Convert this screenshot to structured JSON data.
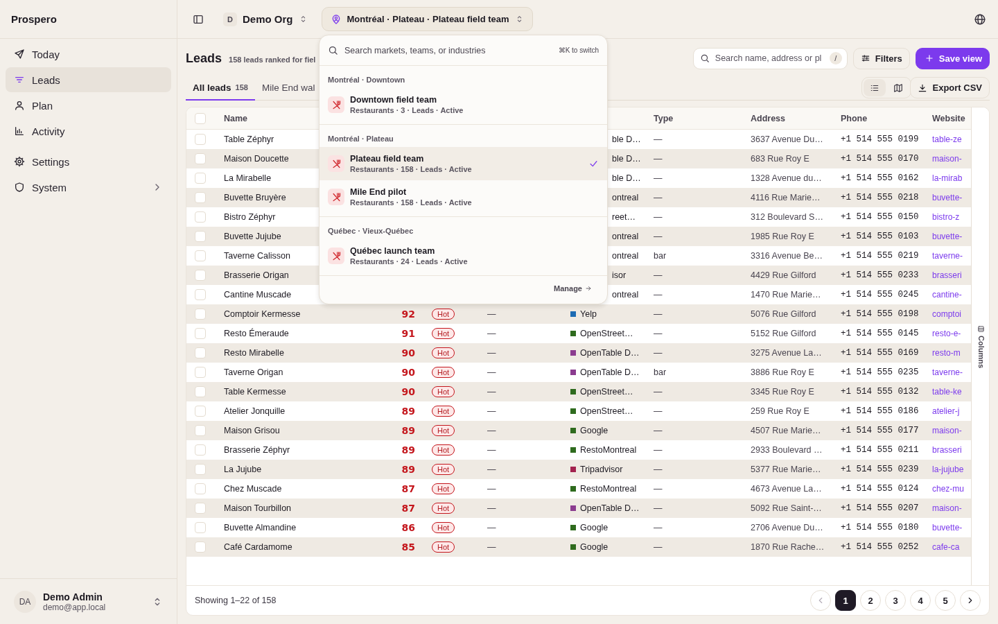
{
  "sidebar": {
    "brand": "Prospero",
    "sections": [
      {
        "items": [
          {
            "label": "Today",
            "selected": false,
            "expandable": false
          },
          {
            "label": "Leads",
            "selected": true,
            "expandable": false
          },
          {
            "label": "Plan",
            "selected": false,
            "expandable": false
          },
          {
            "label": "Activity",
            "selected": false,
            "expandable": false
          }
        ]
      },
      {
        "items": [
          {
            "label": "Settings",
            "selected": false,
            "expandable": false
          },
          {
            "label": "System",
            "selected": false,
            "expandable": true
          }
        ]
      }
    ],
    "user": {
      "initials": "DA",
      "name": "Demo Admin",
      "email": "demo@app.local"
    }
  },
  "topbar": {
    "org": {
      "initial": "D",
      "name": "Demo Org"
    },
    "location": "Montréal · Plateau · Plateau field team",
    "location_open": true
  },
  "header": {
    "title": "Leads",
    "subtitle": "158 leads ranked for fiel",
    "search": {
      "placeholder": "Search name, address or pl",
      "shortcut": "/"
    },
    "filters": "Filters",
    "save": "Save view",
    "tabs": [
      {
        "label": "All leads",
        "count": "158",
        "selected": true
      },
      {
        "label": "Mile End wal",
        "selected": false
      }
    ],
    "views": [
      {
        "selected": true
      },
      {
        "selected": false
      }
    ],
    "export": "Export CSV"
  },
  "table": {
    "select_all": {
      "checked": false
    },
    "columns": [
      {
        "label": "Name"
      },
      {
        "label": "Type"
      },
      {
        "label": "Address"
      },
      {
        "label": "Phone"
      },
      {
        "label": "Website"
      }
    ],
    "rows": [
      {
        "checked": false,
        "covered": true,
        "name": "Table Zéphyr",
        "source": {
          "text": "ble D…"
        },
        "type": "—",
        "address": "3637 Avenue Du…",
        "phone": "+1 514 555 0199",
        "website": "table-ze"
      },
      {
        "checked": false,
        "covered": true,
        "name": "Maison Doucette",
        "source": {
          "text": "ble D…"
        },
        "type": "—",
        "address": "683 Rue Roy E",
        "phone": "+1 514 555 0170",
        "website": "maison-"
      },
      {
        "checked": false,
        "covered": true,
        "name": "La Mirabelle",
        "source": {
          "text": "ble D…"
        },
        "type": "—",
        "address": "1328 Avenue du…",
        "phone": "+1 514 555 0162",
        "website": "la-mirab"
      },
      {
        "checked": false,
        "covered": true,
        "name": "Buvette Bruyère",
        "source": {
          "text": "ontreal"
        },
        "type": "—",
        "address": "4116 Rue Marie…",
        "phone": "+1 514 555 0218",
        "website": "buvette-"
      },
      {
        "checked": false,
        "covered": true,
        "name": "Bistro Zéphyr",
        "source": {
          "text": "reet…"
        },
        "type": "—",
        "address": "312 Boulevard S…",
        "phone": "+1 514 555 0150",
        "website": "bistro-z"
      },
      {
        "checked": false,
        "covered": true,
        "name": "Buvette Jujube",
        "source": {
          "text": "ontreal"
        },
        "type": "—",
        "address": "1985 Rue Roy E",
        "phone": "+1 514 555 0103",
        "website": "buvette-"
      },
      {
        "checked": false,
        "covered": true,
        "name": "Taverne Calisson",
        "source": {
          "text": "ontreal"
        },
        "type": "bar",
        "address": "3316 Avenue Be…",
        "phone": "+1 514 555 0219",
        "website": "taverne-"
      },
      {
        "checked": false,
        "covered": true,
        "name": "Brasserie Origan",
        "source": {
          "text": "isor"
        },
        "type": "—",
        "address": "4429 Rue Gilford",
        "phone": "+1 514 555 0233",
        "website": "brasseri"
      },
      {
        "checked": false,
        "covered": true,
        "name": "Cantine Muscade",
        "source": {
          "text": "ontreal"
        },
        "type": "—",
        "address": "1470 Rue Marie…",
        "phone": "+1 514 555 0245",
        "website": "cantine-"
      },
      {
        "checked": false,
        "covered": false,
        "name": "Comptoir Kermesse",
        "score": "92",
        "status": {
          "label": "Hot",
          "kind": "hot"
        },
        "column_4": "—",
        "source": {
          "text": "Yelp",
          "color": "#1d6bb3"
        },
        "type": "—",
        "address": "5076 Rue Gilford",
        "phone": "+1 514 555 0198",
        "website": "comptoi"
      },
      {
        "checked": false,
        "covered": false,
        "name": "Resto Émeraude",
        "score": "91",
        "status": {
          "label": "Hot",
          "kind": "hot"
        },
        "column_4": "—",
        "source": {
          "text": "OpenStreet…",
          "color": "#2f6b1e"
        },
        "type": "—",
        "address": "5152 Rue Gilford",
        "phone": "+1 514 555 0145",
        "website": "resto-e-"
      },
      {
        "checked": false,
        "covered": false,
        "name": "Resto Mirabelle",
        "score": "90",
        "status": {
          "label": "Hot",
          "kind": "hot"
        },
        "column_4": "—",
        "source": {
          "text": "OpenTable D…",
          "color": "#8b3c8f"
        },
        "type": "—",
        "address": "3275 Avenue La…",
        "phone": "+1 514 555 0169",
        "website": "resto-m"
      },
      {
        "checked": false,
        "covered": false,
        "name": "Taverne Origan",
        "score": "90",
        "status": {
          "label": "Hot",
          "kind": "hot"
        },
        "column_4": "—",
        "source": {
          "text": "OpenTable D…",
          "color": "#8b3c8f"
        },
        "type": "bar",
        "address": "3886 Rue Roy E",
        "phone": "+1 514 555 0235",
        "website": "taverne-"
      },
      {
        "checked": false,
        "covered": false,
        "name": "Table Kermesse",
        "score": "90",
        "status": {
          "label": "Hot",
          "kind": "hot"
        },
        "column_4": "—",
        "source": {
          "text": "OpenStreet…",
          "color": "#2f6b1e"
        },
        "type": "—",
        "address": "3345 Rue Roy E",
        "phone": "+1 514 555 0132",
        "website": "table-ke"
      },
      {
        "checked": false,
        "covered": false,
        "name": "Atelier Jonquille",
        "score": "89",
        "status": {
          "label": "Hot",
          "kind": "hot"
        },
        "column_4": "—",
        "source": {
          "text": "OpenStreet…",
          "color": "#2f6b1e"
        },
        "type": "—",
        "address": "259 Rue Roy E",
        "phone": "+1 514 555 0186",
        "website": "atelier-j"
      },
      {
        "checked": false,
        "covered": false,
        "name": "Maison Grisou",
        "score": "89",
        "status": {
          "label": "Hot",
          "kind": "hot"
        },
        "column_4": "—",
        "source": {
          "text": "Google",
          "color": "#2f6b1e"
        },
        "type": "—",
        "address": "4507 Rue Marie…",
        "phone": "+1 514 555 0177",
        "website": "maison-"
      },
      {
        "checked": false,
        "covered": false,
        "name": "Brasserie Zéphyr",
        "score": "89",
        "status": {
          "label": "Hot",
          "kind": "hot"
        },
        "column_4": "—",
        "source": {
          "text": "RestoMontreal",
          "color": "#2f6b1e"
        },
        "type": "—",
        "address": "2933 Boulevard …",
        "phone": "+1 514 555 0211",
        "website": "brasseri"
      },
      {
        "checked": false,
        "covered": false,
        "name": "La Jujube",
        "score": "89",
        "status": {
          "label": "Hot",
          "kind": "hot"
        },
        "column_4": "—",
        "source": {
          "text": "Tripadvisor",
          "color": "#a3234f"
        },
        "type": "—",
        "address": "5377 Rue Marie…",
        "phone": "+1 514 555 0239",
        "website": "la-jujube"
      },
      {
        "checked": false,
        "covered": false,
        "name": "Chez Muscade",
        "score": "87",
        "status": {
          "label": "Hot",
          "kind": "hot"
        },
        "column_4": "—",
        "source": {
          "text": "RestoMontreal",
          "color": "#2f6b1e"
        },
        "type": "—",
        "address": "4673 Avenue La…",
        "phone": "+1 514 555 0124",
        "website": "chez-mu"
      },
      {
        "checked": false,
        "covered": false,
        "name": "Maison Tourbillon",
        "score": "87",
        "status": {
          "label": "Hot",
          "kind": "hot"
        },
        "column_4": "—",
        "source": {
          "text": "OpenTable D…",
          "color": "#8b3c8f"
        },
        "type": "—",
        "address": "5092 Rue Saint-…",
        "phone": "+1 514 555 0207",
        "website": "maison-"
      },
      {
        "checked": false,
        "covered": false,
        "name": "Buvette Almandine",
        "score": "86",
        "status": {
          "label": "Hot",
          "kind": "hot"
        },
        "column_4": "—",
        "source": {
          "text": "Google",
          "color": "#2f6b1e"
        },
        "type": "—",
        "address": "2706 Avenue Du…",
        "phone": "+1 514 555 0180",
        "website": "buvette-"
      },
      {
        "checked": false,
        "covered": false,
        "name": "Café Cardamome",
        "score": "85",
        "status": {
          "label": "Hot",
          "kind": "hot"
        },
        "column_4": "—",
        "source": {
          "text": "Google",
          "color": "#2f6b1e"
        },
        "type": "—",
        "address": "1870 Rue Rache…",
        "phone": "+1 514 555 0252",
        "website": "cafe-ca"
      }
    ],
    "columns_toggle": "Columns"
  },
  "pagination": {
    "summary": "Showing 1–22 of 158",
    "prev_disabled": true,
    "next_disabled": false,
    "pages": [
      {
        "label": "1",
        "selected": true
      },
      {
        "label": "2",
        "selected": false
      },
      {
        "label": "3",
        "selected": false
      },
      {
        "label": "4",
        "selected": false
      },
      {
        "label": "5",
        "selected": false
      }
    ]
  },
  "location_menu": {
    "search_placeholder": "Search markets, teams, or industries",
    "hint": "⌘K to switch",
    "groups": [
      {
        "label": "Montréal · Downtown",
        "items": [
          {
            "name": "Downtown field team",
            "meta": "Restaurants · 3 · Leads · Active",
            "selected": false
          }
        ]
      },
      {
        "label": "Montréal · Plateau",
        "items": [
          {
            "name": "Plateau field team",
            "meta": "Restaurants · 158 · Leads · Active",
            "selected": true
          },
          {
            "name": "Mile End pilot",
            "meta": "Restaurants · 158 · Leads · Active",
            "selected": false
          }
        ]
      },
      {
        "label": "Québec · Vieux-Québec",
        "items": [
          {
            "name": "Québec launch team",
            "meta": "Restaurants · 24 · Leads · Active",
            "selected": false
          }
        ]
      }
    ],
    "manage": "Manage"
  }
}
